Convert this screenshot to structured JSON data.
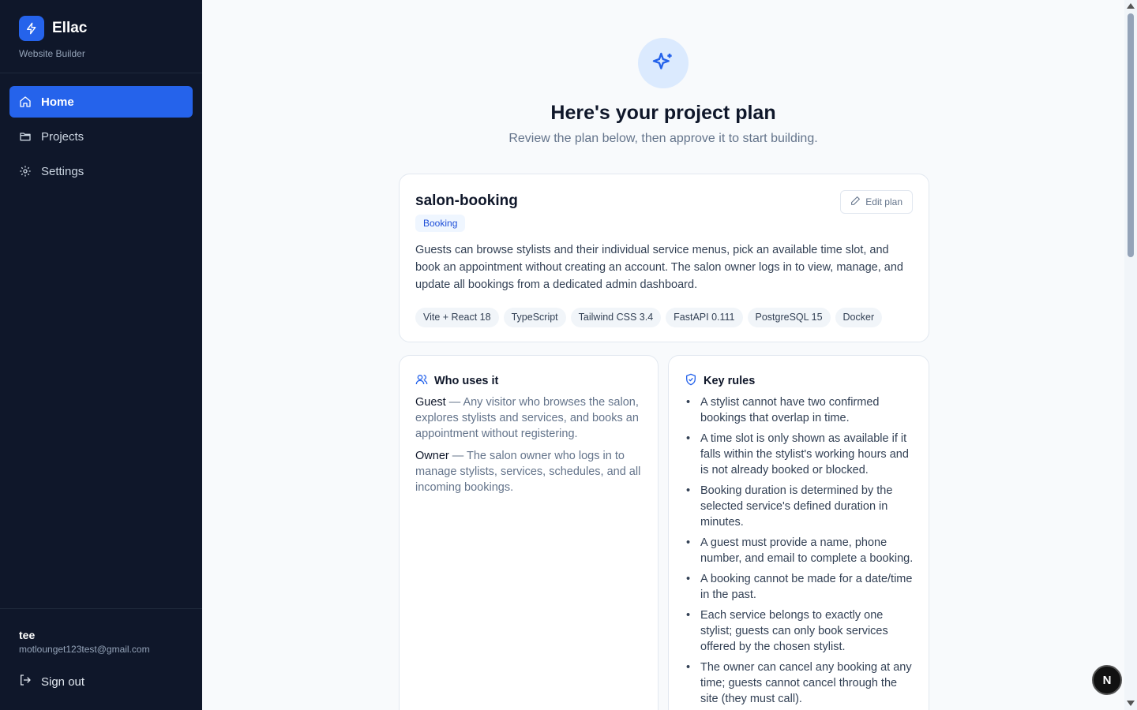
{
  "brand": {
    "name": "Ellac",
    "subtitle": "Website Builder"
  },
  "nav": [
    {
      "label": "Home",
      "icon": "home-icon",
      "active": true
    },
    {
      "label": "Projects",
      "icon": "folder-icon",
      "active": false
    },
    {
      "label": "Settings",
      "icon": "gear-icon",
      "active": false
    }
  ],
  "user": {
    "name": "tee",
    "email": "motlounget123test@gmail.com"
  },
  "signout_label": "Sign out",
  "hero": {
    "title": "Here's your project plan",
    "subtitle": "Review the plan below, then approve it to start building."
  },
  "plan": {
    "name": "salon-booking",
    "type": "Booking",
    "edit_label": "Edit plan",
    "description": "Guests can browse stylists and their individual service menus, pick an available time slot, and book an appointment without creating an account. The salon owner logs in to view, manage, and update all bookings from a dedicated admin dashboard.",
    "tags": [
      "Vite + React 18",
      "TypeScript",
      "Tailwind CSS 3.4",
      "FastAPI 0.111",
      "PostgreSQL 15",
      "Docker"
    ]
  },
  "who": {
    "title": "Who uses it",
    "items": [
      {
        "role": "Guest",
        "desc": " — Any visitor who browses the salon, explores stylists and services, and books an appointment without registering."
      },
      {
        "role": "Owner",
        "desc": " — The salon owner who logs in to manage stylists, services, schedules, and all incoming bookings."
      }
    ]
  },
  "rules": {
    "title": "Key rules",
    "items": [
      "A stylist cannot have two confirmed bookings that overlap in time.",
      "A time slot is only shown as available if it falls within the stylist's working hours and is not already booked or blocked.",
      "Booking duration is determined by the selected service's defined duration in minutes.",
      "A guest must provide a name, phone number, and email to complete a booking.",
      "A booking cannot be made for a date/time in the past.",
      "Each service belongs to exactly one stylist; guests can only book services offered by the chosen stylist.",
      "The owner can cancel any booking at any time; guests cannot cancel through the site (they must call)."
    ]
  },
  "dev_badge": "N",
  "colors": {
    "accent": "#2563eb",
    "sidebar": "#0f172a"
  }
}
